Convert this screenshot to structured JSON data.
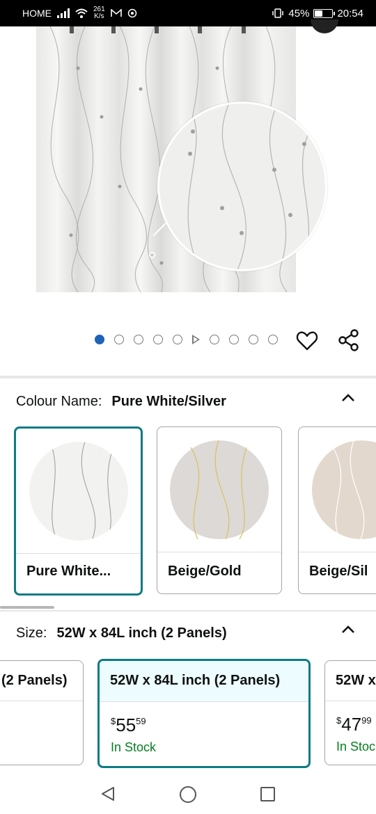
{
  "status_bar": {
    "carrier": "HOME",
    "speed_value": "261",
    "speed_unit": "K/s",
    "battery": "45%",
    "battery_level": 0.45,
    "time": "20:54"
  },
  "carousel": {
    "total_dots": 10,
    "active_index": 0,
    "video_index": 5,
    "icons": {
      "favorite": "heart-icon",
      "share": "share-icon"
    }
  },
  "colour": {
    "label": "Colour Name:",
    "selected": "Pure White/Silver",
    "options": [
      {
        "label": "Pure White...",
        "swatch": "#f2f2f0",
        "line": "#9a9a9a"
      },
      {
        "label": "Beige/Gold",
        "swatch": "#ddd9d6",
        "line": "#d6c160"
      },
      {
        "label": "Beige/Sil",
        "swatch": "#e3d8cd",
        "line": "#ffffff"
      }
    ]
  },
  "size": {
    "label": "Size:",
    "selected": "52W x 84L inch (2 Panels)",
    "options": [
      {
        "label": "(2 Panels)",
        "price_whole": "",
        "price_fraction": "",
        "currency": "",
        "stock": ""
      },
      {
        "label": "52W x 84L inch (2 Panels)",
        "currency": "$",
        "price_whole": "55",
        "price_fraction": "59",
        "stock": "In Stock"
      },
      {
        "label": "52W x",
        "currency": "$",
        "price_whole": "47",
        "price_fraction": "99",
        "stock": "In Stoc"
      }
    ]
  },
  "colors": {
    "accent_teal": "#0d7a86",
    "active_dot": "#1f63b7",
    "in_stock": "#067d1f"
  }
}
